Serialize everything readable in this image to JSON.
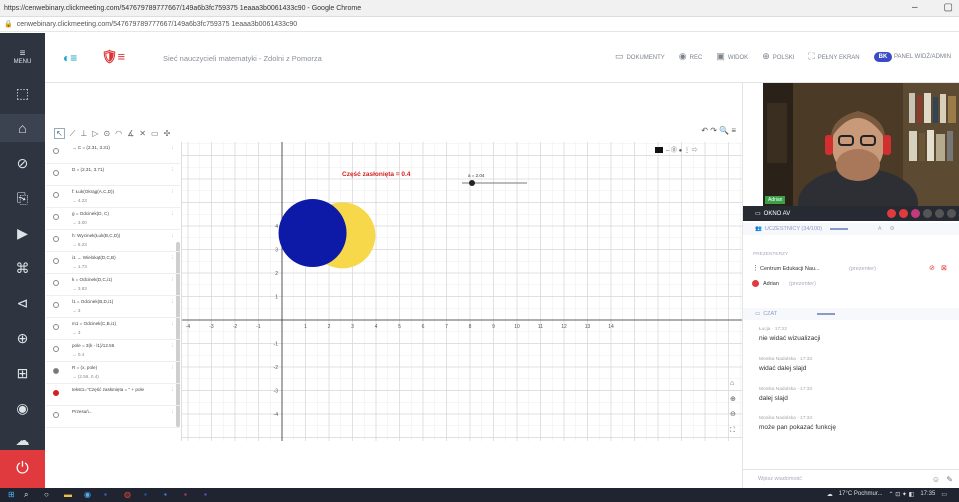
{
  "browser": {
    "title": "https://cenwebinary.clickmeeting.com/547679789777667/149a6b3fc759375 1eaaa3b0061433c90 - Google Chrome",
    "url": "cenwebinary.clickmeeting.com/547679789777667/149a6b3fc759375 1eaaa3b0061433c90"
  },
  "sidebar": {
    "menu_label": "MENU",
    "items": [
      {
        "icon": "camera-icon"
      },
      {
        "icon": "presentation-icon"
      },
      {
        "icon": "edit-icon"
      },
      {
        "icon": "share-icon"
      },
      {
        "icon": "video-icon"
      },
      {
        "icon": "rooms-icon"
      },
      {
        "icon": "screen-share-icon"
      },
      {
        "icon": "lock-icon"
      },
      {
        "icon": "grid-icon"
      },
      {
        "icon": "broadcast-icon"
      },
      {
        "icon": "cloud-icon"
      }
    ]
  },
  "topnav": {
    "event_title": "Sieć nauczycieli matematyki - Zdolni z Pomorza",
    "buttons": [
      "DOKUMENTY",
      "REC",
      "WIDOK",
      "POLSKI",
      "PEŁNY EKRAN"
    ],
    "user_initials": "BK",
    "user_label": "PANEL WIDŻ/ADMIN"
  },
  "geogebra": {
    "tools": [
      "↖",
      "⟋",
      "⊥",
      "▷",
      "⊙",
      "◠",
      "∡",
      "✕",
      "▭",
      "✣"
    ],
    "undo_redo": "↶ ↷ 🔍 ≡",
    "algebra_rows": [
      {
        "l1": "→ C = (2.31, 3.31)",
        "l2": ""
      },
      {
        "l1": "D = (2.31, 3.71)",
        "l2": ""
      },
      {
        "l1": "f: Łuk(Okrąg(A,C,D))",
        "l2": "→ 4.23"
      },
      {
        "l1": "g = Odcinek(D, C)",
        "l2": "→ 3.00"
      },
      {
        "l1": "h: Wycinek(Łuk(B,C,D))",
        "l2": "→ 8.23"
      },
      {
        "l1": "i1 → Wielokąt(D,C,B)",
        "l2": "→ 1.73"
      },
      {
        "l1": "k = Odcinek(D,C,i1)",
        "l2": "→ 3.83"
      },
      {
        "l1": "l1 = Odcinek(B,D,i1)",
        "l2": "→ 3"
      },
      {
        "l1": "m1 = Odcinek(C,B,i1)",
        "l2": "→ 3"
      },
      {
        "l1": "pole = 3(k - l1)/12.56",
        "l2": "→ 0.4"
      },
      {
        "l1": "R = (x, pole)",
        "l2": "→ (2.56, 0.4)"
      },
      {
        "l1": "tekst1=\"Część zasłonięta = \" + pole",
        "l2": ""
      },
      {
        "l1": "Przesuń...",
        "l2": ""
      }
    ],
    "graph_text": "Część zasłonięta = 0.4",
    "slider_label": "a = 2.04",
    "x_ticks": [
      "-4",
      "-3",
      "-2",
      "-1",
      "1",
      "2",
      "3",
      "4",
      "5",
      "6",
      "7",
      "8",
      "9",
      "10",
      "11",
      "12",
      "13",
      "14"
    ],
    "y_ticks": [
      "4",
      "3",
      "2",
      "1",
      "-1",
      "-2",
      "-3",
      "-4"
    ],
    "colors": {
      "blue": "#0d1aa8",
      "yellow": "#f6d84a",
      "red_text": "#d52020"
    }
  },
  "webcam": {
    "name": "Adrian",
    "bar_label": "OKNO AV"
  },
  "participants": {
    "header": "UCZESTNICY (34/100)",
    "section": "PREZENTERZY",
    "items": [
      {
        "name": "Centrum Edukacji Nau...",
        "role": "(prezenter)"
      },
      {
        "name": "Adrian",
        "role": "(prezenter)"
      }
    ]
  },
  "chat": {
    "header": "CZAT",
    "messages": [
      {
        "who": "Łucja · 17:33",
        "text": "nie widać wizualizacji"
      },
      {
        "who": "Monika Nadolska · 17:33",
        "text": "widać dalej slajd"
      },
      {
        "who": "Monika Nadolska · 17:33",
        "text": "dalej slajd"
      },
      {
        "who": "Monika Nadolska · 17:34",
        "text": "może pan pokazać funkcję"
      }
    ],
    "input_placeholder": "Wpisz wiadomość"
  },
  "taskbar": {
    "weather": "17°C Pochmur...",
    "time": "17:35"
  }
}
